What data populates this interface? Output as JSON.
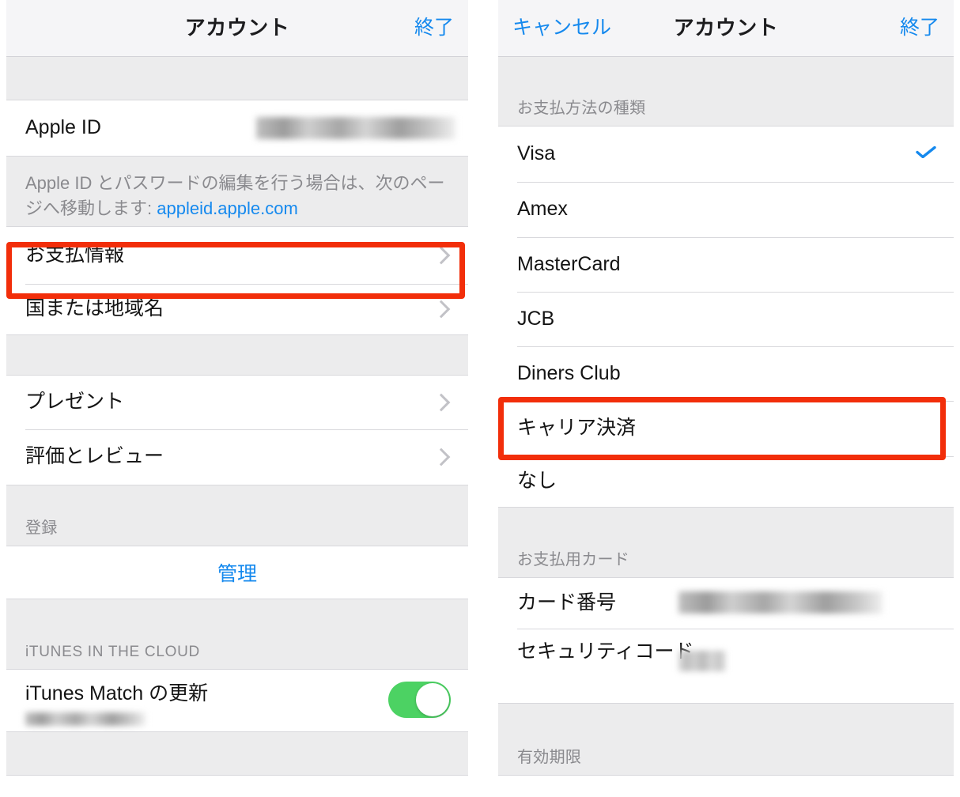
{
  "left_screen": {
    "navbar": {
      "title": "アカウント",
      "right_button": "終了"
    },
    "apple_id_row": {
      "label": "Apple ID",
      "value_redacted": true
    },
    "footnote": {
      "text_before": "Apple ID とパスワードの編集を行う場合は、次のページへ移動します: ",
      "link": "appleid.apple.com"
    },
    "rows_group_1": [
      {
        "label": "お支払情報",
        "accessory": "chevron-right-icon",
        "highlighted": true
      },
      {
        "label": "国または地域名",
        "accessory": "chevron-right-icon",
        "highlighted": false
      }
    ],
    "rows_group_2": [
      {
        "label": "プレゼント",
        "accessory": "chevron-right-icon"
      },
      {
        "label": "評価とレビュー",
        "accessory": "chevron-right-icon"
      }
    ],
    "subscriptions_header": "登録",
    "manage_button": "管理",
    "itunes_cloud_header": "iTUNES IN THE CLOUD",
    "itunes_match_row": {
      "label": "iTunes Match の更新",
      "sublabel_redacted": true,
      "toggle_on": true,
      "toggle_color": "#4cd263"
    }
  },
  "right_screen": {
    "navbar": {
      "left_button": "キャンセル",
      "title": "アカウント",
      "right_button": "終了"
    },
    "payment_type_header": "お支払方法の種類",
    "payment_types": [
      {
        "label": "Visa",
        "selected": true
      },
      {
        "label": "Amex",
        "selected": false
      },
      {
        "label": "MasterCard",
        "selected": false
      },
      {
        "label": "JCB",
        "selected": false
      },
      {
        "label": "Diners Club",
        "selected": false
      },
      {
        "label": "キャリア決済",
        "selected": false,
        "highlighted": true
      },
      {
        "label": "なし",
        "selected": false
      }
    ],
    "payment_card_header": "お支払用カード",
    "card_rows": [
      {
        "label": "カード番号",
        "value_redacted": true
      },
      {
        "label": "セキュリティコード",
        "value_redacted": true
      }
    ],
    "expiry_header": "有効期限"
  },
  "colors": {
    "accent_blue": "#1589ee",
    "annotation_red": "#f22e0a",
    "toggle_green": "#4cd263",
    "group_bg": "#ececed",
    "row_bg": "#ffffff",
    "separator": "#d8d8dc",
    "secondary_text": "#8a8a8e"
  }
}
